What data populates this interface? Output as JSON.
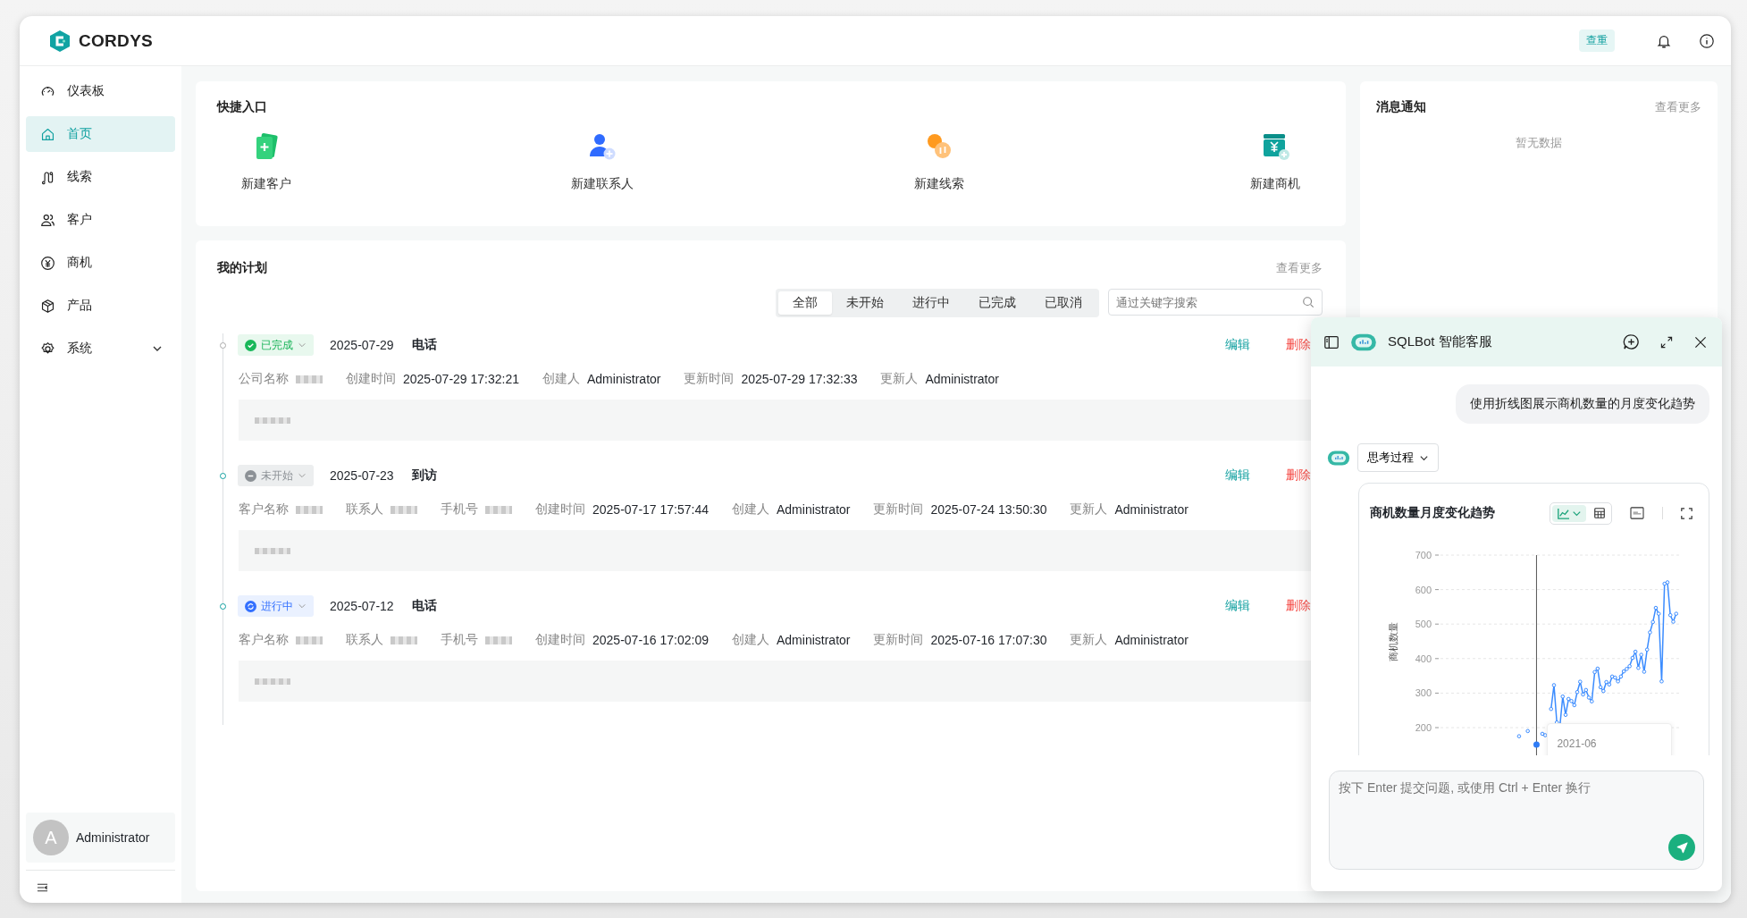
{
  "header": {
    "brand": "CORDYS",
    "dedupe_button": "查重"
  },
  "sidebar": {
    "items": [
      {
        "label": "仪表板",
        "selected": false
      },
      {
        "label": "首页",
        "selected": true
      },
      {
        "label": "线索",
        "selected": false
      },
      {
        "label": "客户",
        "selected": false
      },
      {
        "label": "商机",
        "selected": false
      },
      {
        "label": "产品",
        "selected": false
      },
      {
        "label": "系统",
        "selected": false,
        "expanded": false
      }
    ],
    "user": {
      "avatar": "A",
      "name": "Administrator"
    }
  },
  "quick_entry": {
    "title": "快捷入口",
    "items": [
      "新建客户",
      "新建联系人",
      "新建线索",
      "新建商机"
    ]
  },
  "plan": {
    "title": "我的计划",
    "more": "查看更多",
    "filters": [
      {
        "label": "全部",
        "selected": true
      },
      {
        "label": "未开始",
        "selected": false
      },
      {
        "label": "进行中",
        "selected": false
      },
      {
        "label": "已完成",
        "selected": false
      },
      {
        "label": "已取消",
        "selected": false
      }
    ],
    "search": {
      "placeholder": "通过关键字搜索"
    },
    "items": [
      {
        "status": {
          "kind": "done",
          "label": "已完成"
        },
        "date": "2025-07-29",
        "type": "电话",
        "edit": "编辑",
        "delete": "删除",
        "fields": [
          {
            "label": "公司名称",
            "redacted": true
          },
          {
            "label": "创建时间",
            "value": "2025-07-29 17:32:21"
          },
          {
            "label": "创建人",
            "value": "Administrator"
          },
          {
            "label": "更新时间",
            "value": "2025-07-29 17:32:33"
          },
          {
            "label": "更新人",
            "value": "Administrator"
          }
        ],
        "note_redacted": true
      },
      {
        "status": {
          "kind": "not_started",
          "label": "未开始"
        },
        "date": "2025-07-23",
        "type": "到访",
        "edit": "编辑",
        "delete": "删除",
        "fields": [
          {
            "label": "客户名称",
            "redacted": true
          },
          {
            "label": "联系人",
            "redacted": true
          },
          {
            "label": "手机号",
            "redacted": true
          },
          {
            "label": "创建时间",
            "value": "2025-07-17 17:57:44"
          },
          {
            "label": "创建人",
            "value": "Administrator"
          },
          {
            "label": "更新时间",
            "value": "2025-07-24 13:50:30"
          },
          {
            "label": "更新人",
            "value": "Administrator"
          }
        ],
        "note_redacted": true
      },
      {
        "status": {
          "kind": "in_progress",
          "label": "进行中"
        },
        "date": "2025-07-12",
        "type": "电话",
        "edit": "编辑",
        "delete": "删除",
        "fields": [
          {
            "label": "客户名称",
            "redacted": true
          },
          {
            "label": "联系人",
            "redacted": true
          },
          {
            "label": "手机号",
            "redacted": true
          },
          {
            "label": "创建时间",
            "value": "2025-07-16 17:02:09"
          },
          {
            "label": "创建人",
            "value": "Administrator"
          },
          {
            "label": "更新时间",
            "value": "2025-07-16 17:07:30"
          },
          {
            "label": "更新人",
            "value": "Administrator"
          }
        ],
        "note_redacted": true
      }
    ]
  },
  "notifications": {
    "title": "消息通知",
    "more": "查看更多",
    "empty": "暂无数据"
  },
  "chat": {
    "title": "SQLBot 智能客服",
    "user_message": "使用折线图展示商机数量的月度变化趋势",
    "thinking": "思考过程",
    "chart": {
      "title": "商机数量月度变化趋势",
      "views": [
        {
          "kind": "line",
          "selected": true
        },
        {
          "kind": "table",
          "selected": false
        }
      ],
      "tooltip": "2021-06",
      "y_axis_label": "商机数量",
      "y_ticks": [
        "700",
        "600",
        "500",
        "400",
        "300",
        "200"
      ]
    },
    "input": {
      "placeholder": "按下 Enter 提交问题, 或使用 Ctrl + Enter 换行"
    }
  }
}
